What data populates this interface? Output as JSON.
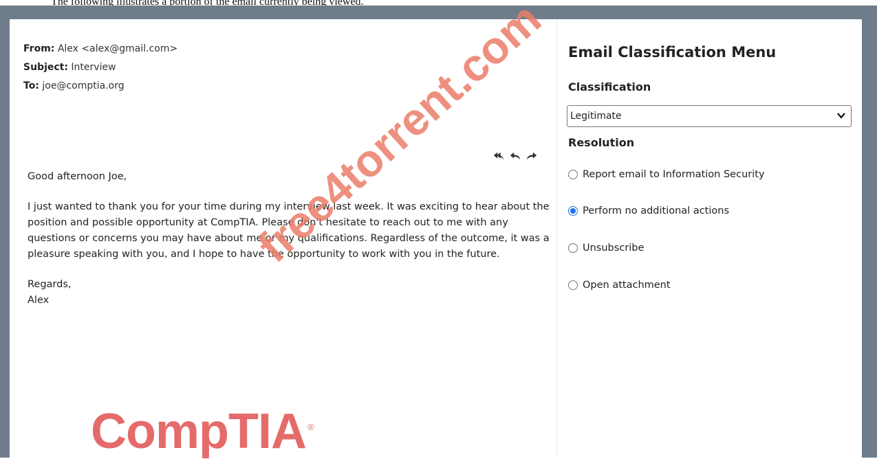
{
  "caption": "The following illustrates a portion of the email currently being viewed.",
  "email": {
    "from_label": "From:",
    "from_value": "Alex <alex@gmail.com>",
    "subject_label": "Subject:",
    "subject_value": "Interview",
    "to_label": "To:",
    "to_value": "joe@comptia.org",
    "greeting": "Good afternoon Joe,",
    "paragraph": "I just wanted to thank you for your time during my interview last week. It was exciting to hear about the position and possible opportunity at CompTIA. Please don't hesitate to reach out to me with any questions or concerns you may have about me or my qualifications. Regardless of the outcome, it was a pleasure speaking with you, and I hope to have the opportunity to work with you in the future.",
    "closing": "Regards,",
    "signature": "Alex",
    "actions": [
      "reply-all-icon",
      "reply-icon",
      "forward-icon"
    ]
  },
  "logo": {
    "text": "CompTIA",
    "mark": "®",
    "color": "#e56b6b"
  },
  "watermark": "free4torrent.com",
  "menu": {
    "title": "Email Classification Menu",
    "classification_label": "Classification",
    "classification_value": "Legitimate",
    "resolution_label": "Resolution",
    "options": [
      {
        "label": "Report email to Information Security",
        "checked": false
      },
      {
        "label": "Perform no additional actions",
        "checked": true
      },
      {
        "label": "Unsubscribe",
        "checked": false
      },
      {
        "label": "Open attachment",
        "checked": false
      }
    ],
    "accent": "#1a73e8"
  }
}
